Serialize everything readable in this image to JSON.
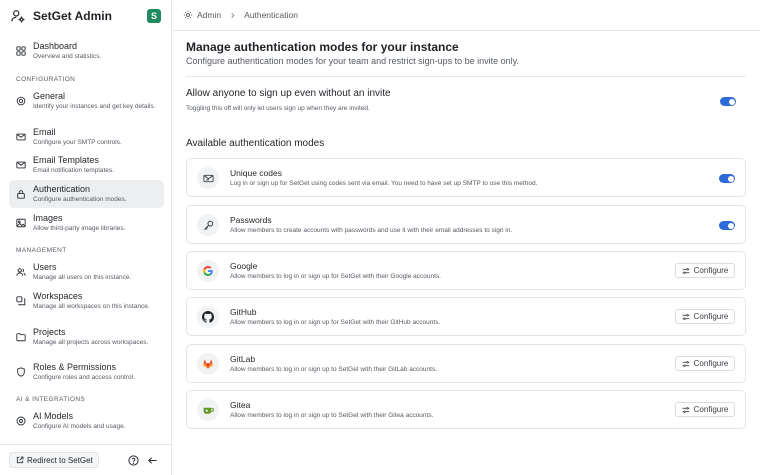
{
  "app": {
    "title": "SetGet Admin",
    "avatar_letter": "S"
  },
  "sidebar": {
    "items": [
      {
        "label": "Dashboard",
        "desc": "Overview and statistics.",
        "icon": "grid-icon"
      },
      {
        "label": "General",
        "desc": "Identify your instances and get key details.",
        "icon": "settings-icon"
      },
      {
        "label": "Email",
        "desc": "Configure your SMTP controls.",
        "icon": "mail-icon"
      },
      {
        "label": "Email Templates",
        "desc": "Email notification templates.",
        "icon": "mail-template-icon"
      },
      {
        "label": "Authentication",
        "desc": "Configure authentication modes.",
        "icon": "lock-icon",
        "active": true
      },
      {
        "label": "Images",
        "desc": "Allow third-party image libraries.",
        "icon": "image-icon"
      },
      {
        "label": "Users",
        "desc": "Manage all users on this instance.",
        "icon": "users-icon"
      },
      {
        "label": "Workspaces",
        "desc": "Manage all workspaces on this instance.",
        "icon": "workspaces-icon"
      },
      {
        "label": "Projects",
        "desc": "Manage all projects across workspaces.",
        "icon": "folder-icon"
      },
      {
        "label": "Roles & Permissions",
        "desc": "Configure roles and access control.",
        "icon": "shield-icon"
      },
      {
        "label": "AI Models",
        "desc": "Configure AI models and usage.",
        "icon": "ai-icon"
      }
    ],
    "sections": {
      "configuration": "CONFIGURATION",
      "management": "MANAGEMENT",
      "ai": "AI & INTEGRATIONS"
    },
    "footer": {
      "redirect_label": "Redirect to SetGet"
    }
  },
  "breadcrumb": {
    "root": "Admin",
    "current": "Authentication"
  },
  "main": {
    "title": "Manage authentication modes for your instance",
    "subtitle": "Configure authentication modes for your team and restrict sign-ups to be invite only.",
    "signup_setting": {
      "title": "Allow anyone to sign up even without an invite",
      "desc": "Toggling this off will only let users sign up when they are invited.",
      "enabled": true
    },
    "available_title": "Available authentication modes",
    "modes": [
      {
        "name": "Unique codes",
        "desc": "Log in or sign up for SetGet using codes sent via email. You need to have set up SMTP to use this method.",
        "icon": "mail-icon",
        "control": "toggle",
        "enabled": true
      },
      {
        "name": "Passwords",
        "desc": "Allow members to create accounts with passwords and use it with their email addresses to sign in.",
        "icon": "key-icon",
        "control": "toggle",
        "enabled": true
      },
      {
        "name": "Google",
        "desc": "Allow members to log in or sign up for SetGet with their Google accounts.",
        "icon": "google-icon",
        "control": "configure",
        "button_label": "Configure"
      },
      {
        "name": "GitHub",
        "desc": "Allow members to log in or sign up for SetGet with their GitHub accounts.",
        "icon": "github-icon",
        "control": "configure",
        "button_label": "Configure"
      },
      {
        "name": "GitLab",
        "desc": "Allow members to log in or sign up to SetGet with their GitLab accounts.",
        "icon": "gitlab-icon",
        "control": "configure",
        "button_label": "Configure"
      },
      {
        "name": "Gitea",
        "desc": "Allow members to log in or sign up to SetGet with their Gitea accounts.",
        "icon": "gitea-icon",
        "control": "configure",
        "button_label": "Configure"
      }
    ]
  },
  "colors": {
    "accent": "#2e6ad8",
    "active_nav": "#eceef0",
    "avatar": "#1f8a5b"
  }
}
